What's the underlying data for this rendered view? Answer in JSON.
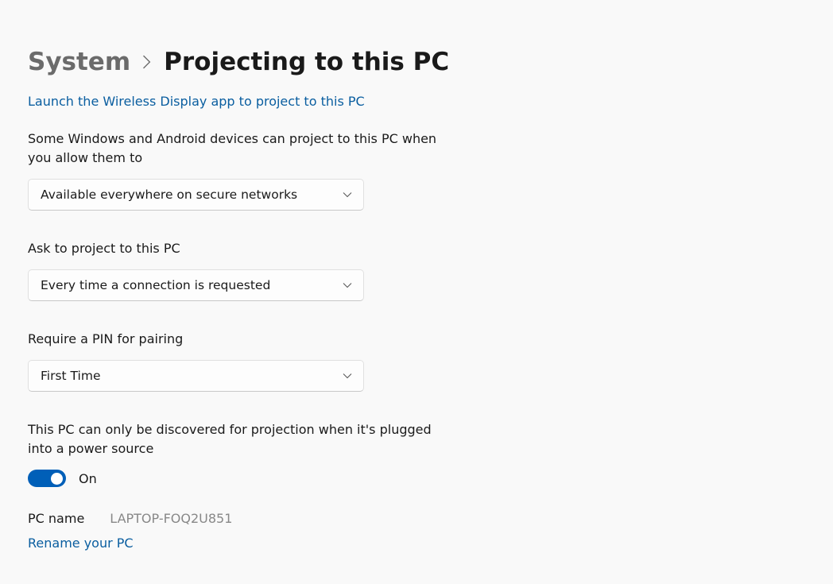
{
  "breadcrumb": {
    "parent": "System",
    "current": "Projecting to this PC"
  },
  "launch_link": "Launch the Wireless Display app to project to this PC",
  "settings": {
    "availability": {
      "label": "Some Windows and Android devices can project to this PC when you allow them to",
      "value": "Available everywhere on secure networks"
    },
    "ask": {
      "label": "Ask to project to this PC",
      "value": "Every time a connection is requested"
    },
    "pin": {
      "label": "Require a PIN for pairing",
      "value": "First Time"
    },
    "power": {
      "label": "This PC can only be discovered for projection when it's plugged into a power source",
      "state": "On"
    }
  },
  "pc": {
    "name_label": "PC name",
    "name_value": "LAPTOP-FOQ2U851",
    "rename_link": "Rename your PC"
  }
}
